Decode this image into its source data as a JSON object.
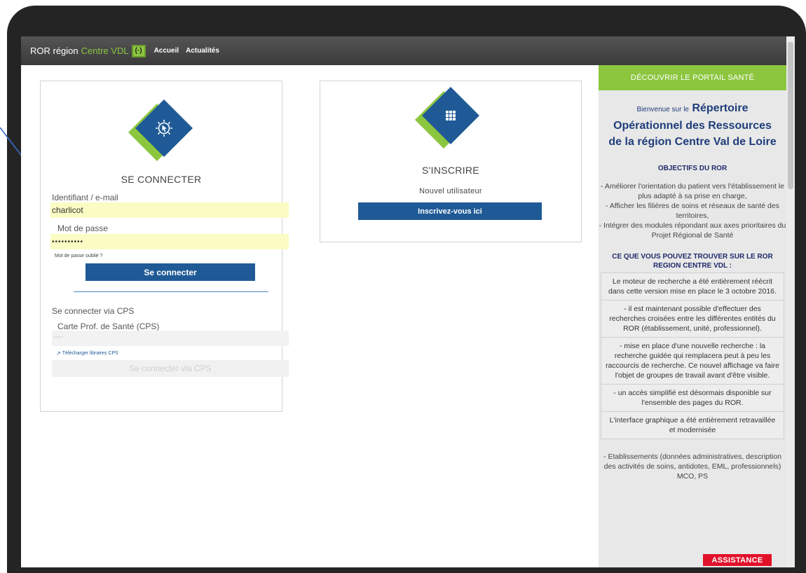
{
  "navbar": {
    "brand_prefix": "ROR région",
    "brand_accent": "Centre VDL",
    "brand_logo": "(·)",
    "links": [
      "Accueil",
      "Actualités"
    ]
  },
  "login": {
    "title": "SE CONNECTER",
    "identifier_label": "Identifiant / e-mail",
    "identifier_value": "charlicot",
    "password_label": "Mot de passe",
    "password_value": "••••••••••",
    "forgot_password": "Mot de passe oublié ?",
    "submit_label": "Se connecter",
    "cps_heading": "Se connecter via CPS",
    "cps_label": "Carte Prof. de Santé (CPS)",
    "cps_placeholder": "****",
    "cps_download": "Télécharger libraires CPS",
    "cps_submit": "Se connecter via CPS"
  },
  "signup": {
    "title": "S'INSCRIRE",
    "subtitle": "Nouvel utilisateur",
    "button_label": "Inscrivez-vous ici"
  },
  "sidebar": {
    "header": "DÉCOUVRIR LE PORTAIL SANTÉ",
    "welcome_pre": "Bienvenue sur le",
    "welcome_line1": "Répertoire",
    "welcome_line2": "Opérationnel des Ressources",
    "welcome_line3": "de la région Centre Val de Loire",
    "objectives_title": "OBJECTIFS DU ROR",
    "objectives": [
      "- Améliorer l'orientation du patient vers l'établissement le plus adapté à sa prise en charge,",
      "- Afficher les filières de soins et réseaux de santé des territoires,",
      "- Intégrer des modules répondant aux axes prioritaires du Projet Régional de Santé"
    ],
    "find_title": "CE QUE VOUS POUVEZ TROUVER SUR LE ROR REGION CENTRE VDL :",
    "boxes": [
      "Le moteur de recherche a été entièrement réécrit dans cette version mise en place le 3 octobre 2016.",
      "- il est maintenant possible d'effectuer des recherches croisées entre les différentes entités du ROR (établissement, unité, professionnel).",
      "- mise en place d'une nouvelle recherche : la recherche guidée qui remplacera peut à peu les raccourcis de recherche. Ce nouvel affichage va faire l'objet de groupes de travail avant d'être visible.",
      "- un accès simplifié est désormais disponible sur l'ensemble des pages du ROR.",
      "L'interface graphique a été entièrement retravaillée et modernisée"
    ],
    "footer_text": "- Etablissements (données administratives, description des activités de soins, antidotes, EML, professionnels) MCO, PS",
    "assistance": "ASSISTANCE"
  },
  "colors": {
    "brand_green": "#8cc63f",
    "brand_blue": "#1f5a96",
    "assist_red": "#e2112a"
  },
  "icons": [
    "cursor-gear-icon",
    "grid-icon",
    "external-link-icon",
    "annotation-arrow"
  ]
}
